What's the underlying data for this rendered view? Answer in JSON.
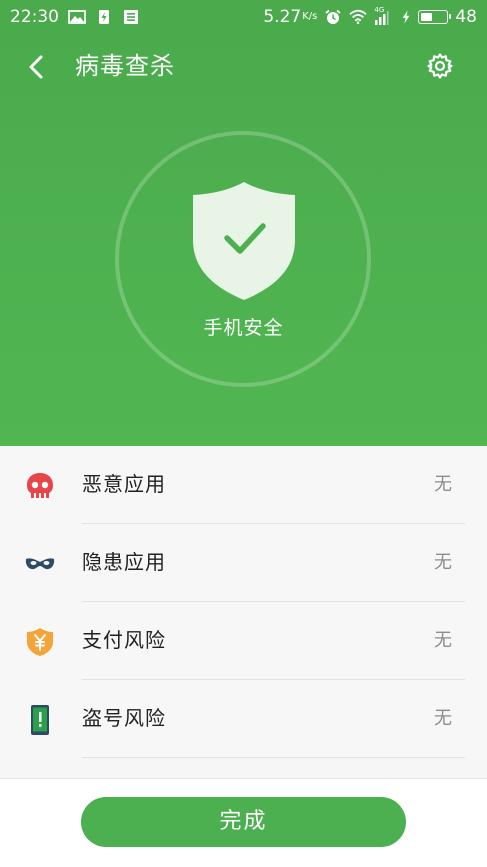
{
  "status_bar": {
    "time": "22:30",
    "network_speed": "5.27",
    "speed_unit": "K/s",
    "network_type": "4G",
    "battery_level": "48",
    "battery_fraction": 0.46
  },
  "title_bar": {
    "title": "病毒查杀",
    "back_icon": "chevron-left-icon",
    "settings_icon": "gear-icon"
  },
  "scan_result": {
    "status_text": "手机安全",
    "icon": "shield-check-icon"
  },
  "risk_list": [
    {
      "label": "恶意应用",
      "value": "无",
      "icon": "skull-icon",
      "icon_color": "#e8454a"
    },
    {
      "label": "隐患应用",
      "value": "无",
      "icon": "mask-icon",
      "icon_color": "#2f4a66"
    },
    {
      "label": "支付风险",
      "value": "无",
      "icon": "yen-shield-icon",
      "icon_color": "#f5a43a"
    },
    {
      "label": "盗号风险",
      "value": "无",
      "icon": "phone-alert-icon",
      "icon_color": "#2aa04a"
    }
  ],
  "done_button": {
    "label": "完成"
  },
  "colors": {
    "primary_green": "#4caf50",
    "header_green": "#4aaa4c",
    "value_gray": "#8c8c8c"
  }
}
